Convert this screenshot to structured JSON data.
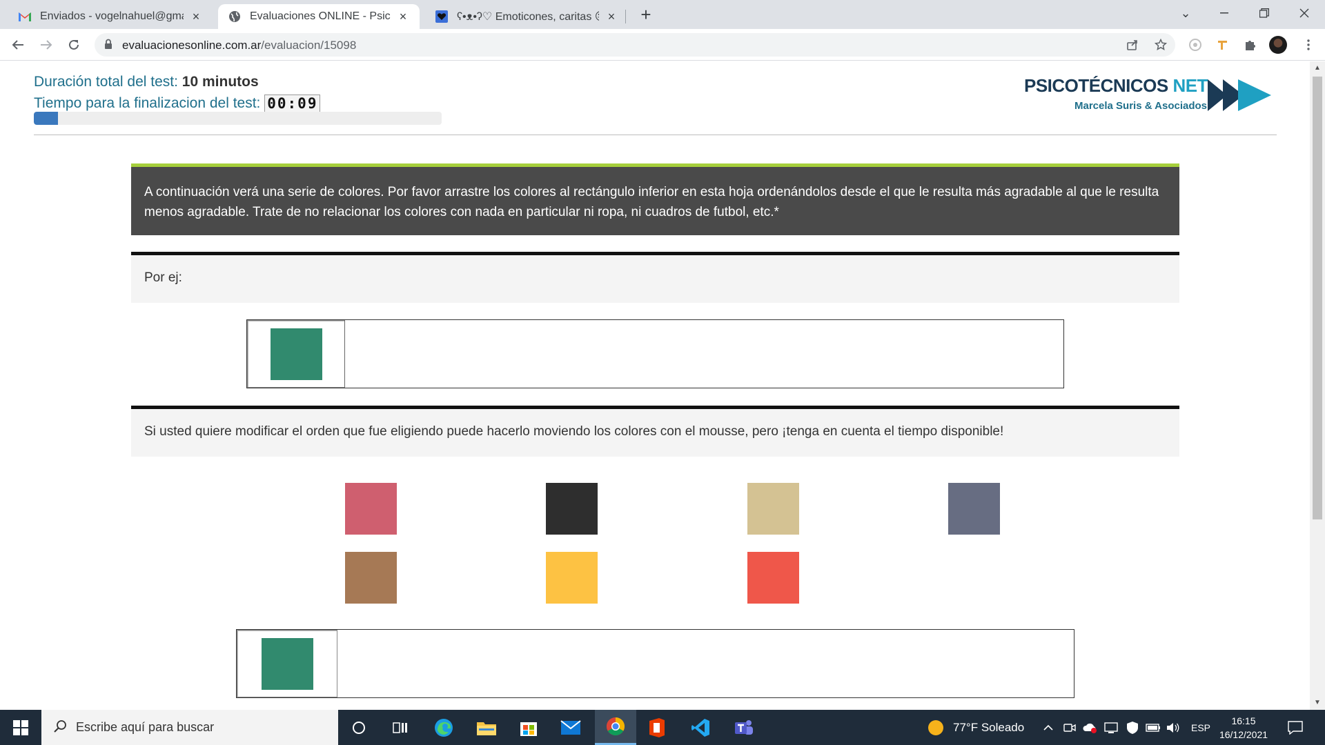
{
  "browser": {
    "tabs": [
      {
        "title": "Enviados - vogelnahuel@gmail.com",
        "active": false
      },
      {
        "title": "Evaluaciones ONLINE - Psicotécnicos",
        "active": true
      },
      {
        "title": "ʕ•ᴥ•ʔ♡ Emoticones, caritas 😛",
        "active": false
      }
    ],
    "new_tab": "+",
    "url_host": "evaluacionesonline.com.ar",
    "url_path": "/evaluacion/15098"
  },
  "test": {
    "duration_label": "Duración total del test:",
    "duration_value": "10 minutos",
    "remaining_label": "Tiempo para la finalizacion del test:",
    "timer": "00:09",
    "progress_percent": 6
  },
  "logo": {
    "name": "PSICOTÉCNICOS",
    "name_suffix": "NET",
    "subtitle": "Marcela Suris & Asociados"
  },
  "instructions": "A continuación verá una serie de colores. Por favor arrastre los colores al rectángulo inferior en esta hoja ordenándolos desde el que le resulta más agradable al que le resulta menos agradable. Trate de no relacionar los colores con nada en particular ni ropa, ni cuadros de futbol, etc.*",
  "example_label": "Por ej:",
  "example_color": "#318a6e",
  "modify_note": "Si usted quiere modificar el orden que fue eligiendo puede hacerlo moviendo los colores con el mousse, pero ¡tenga en cuenta el tiempo disponible!",
  "palette": [
    {
      "name": "pink",
      "color": "#cf5f6f"
    },
    {
      "name": "black",
      "color": "#2e2e2e"
    },
    {
      "name": "beige",
      "color": "#d4c293"
    },
    {
      "name": "gray-blue",
      "color": "#676d82"
    },
    {
      "name": "brown",
      "color": "#a67955"
    },
    {
      "name": "yellow",
      "color": "#fdc243"
    },
    {
      "name": "red",
      "color": "#ef574a"
    }
  ],
  "answer": [
    {
      "name": "green",
      "color": "#318a6e"
    }
  ],
  "taskbar": {
    "search_placeholder": "Escribe aquí para buscar",
    "weather": "77°F  Soleado",
    "language": "ESP",
    "time": "16:15",
    "date": "16/12/2021"
  }
}
